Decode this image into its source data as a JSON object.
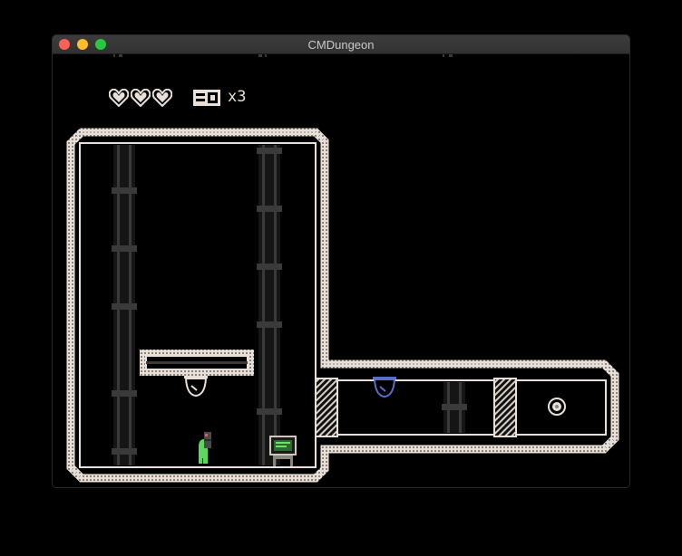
{
  "window": {
    "title": "CMDungeon",
    "controls": {
      "close_color": "#fe5f57",
      "minimize_color": "#febc2e",
      "maximize_color": "#28c840"
    }
  },
  "hud": {
    "hearts_total": 3,
    "hearts_filled": 3,
    "keys_label": "x3",
    "keys_count": 3,
    "key_icon": "keycard-icon",
    "heart_icon": "heart-icon"
  },
  "colors": {
    "wall": "#e8e0d8",
    "pillar": "#3a3a3a",
    "player": "#5fd65f",
    "terminal_screen": "#2c6b2c",
    "ceiling_lamp_blue": "#5a6fc8",
    "background": "#000000"
  },
  "objects": [
    {
      "name": "player-character",
      "icon": "player-icon"
    },
    {
      "name": "computer-terminal",
      "icon": "terminal-icon"
    },
    {
      "name": "ceiling-lamp-white",
      "icon": "lamp-icon"
    },
    {
      "name": "ceiling-lamp-blue",
      "icon": "lamp-icon"
    },
    {
      "name": "glowing-orb",
      "icon": "orb-icon"
    },
    {
      "name": "hatched-door-left",
      "icon": "door-icon"
    },
    {
      "name": "hatched-door-right",
      "icon": "door-icon"
    }
  ]
}
